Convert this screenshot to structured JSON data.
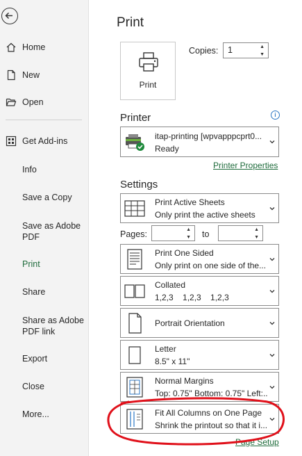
{
  "sidebar": {
    "items": [
      {
        "label": "Home",
        "icon": "home-icon"
      },
      {
        "label": "New",
        "icon": "new-document-icon"
      },
      {
        "label": "Open",
        "icon": "open-folder-icon"
      },
      {
        "label": "Get Add-ins",
        "icon": "add-ins-grid-icon"
      },
      {
        "label": "Info"
      },
      {
        "label": "Save a Copy"
      },
      {
        "label": "Save as Adobe PDF"
      },
      {
        "label": "Print",
        "active": true
      },
      {
        "label": "Share"
      },
      {
        "label": "Share as Adobe PDF link"
      },
      {
        "label": "Export"
      },
      {
        "label": "Close"
      },
      {
        "label": "More..."
      }
    ]
  },
  "main": {
    "title": "Print",
    "print_button": "Print",
    "copies_label": "Copies:",
    "copies_value": "1",
    "printer_heading": "Printer",
    "printer_name": "itap-printing [wpvapppcprt0...",
    "printer_status": "Ready",
    "printer_properties": "Printer Properties",
    "settings_heading": "Settings",
    "pages_label": "Pages:",
    "to_label": "to",
    "page_setup": "Page Setup",
    "settings": [
      {
        "title": "Print Active Sheets",
        "desc": "Only print the active sheets",
        "icon": "sheets-grid-icon"
      },
      {
        "title": "Print One Sided",
        "desc": "Only print on one side of the...",
        "icon": "one-sided-page-icon"
      },
      {
        "title": "Collated",
        "desc": "1,2,3    1,2,3    1,2,3",
        "icon": "collated-icon"
      },
      {
        "title": "Portrait Orientation",
        "desc": "",
        "icon": "portrait-page-icon"
      },
      {
        "title": "Letter",
        "desc": "8.5\" x 11\"",
        "icon": "letter-page-icon"
      },
      {
        "title": "Normal Margins",
        "desc": "Top: 0.75\" Bottom: 0.75\" Left:...",
        "icon": "margins-icon"
      },
      {
        "title": "Fit All Columns on One Page",
        "desc": "Shrink the printout so that it i...",
        "icon": "fit-columns-icon"
      }
    ]
  },
  "colors": {
    "accent": "#1e6b3b",
    "annotation": "#e0101a",
    "info": "#2b77c4"
  }
}
